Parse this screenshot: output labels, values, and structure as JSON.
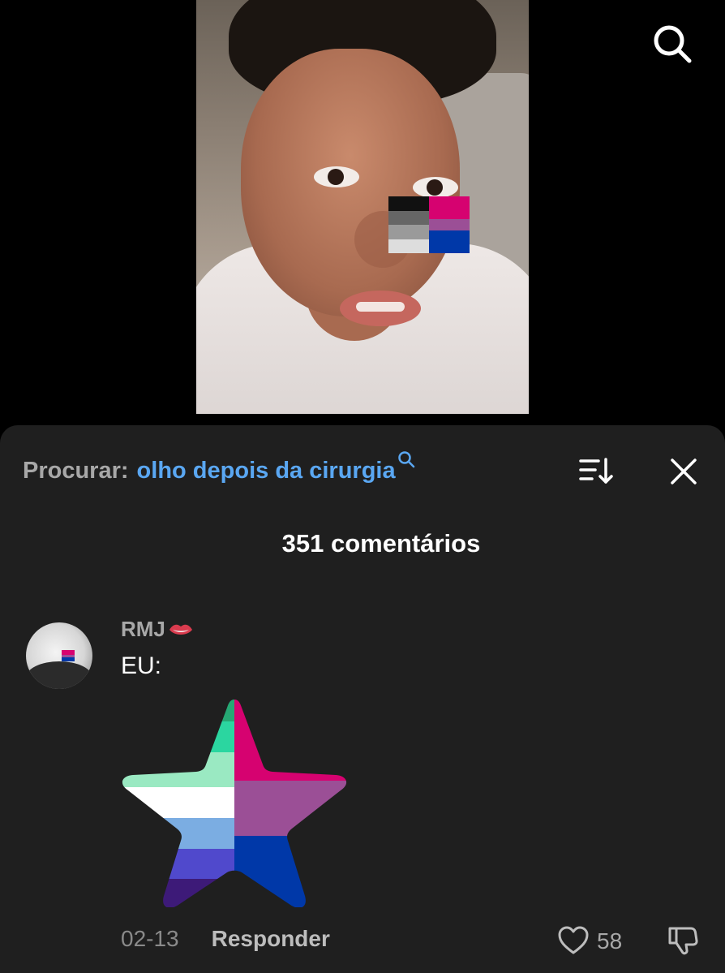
{
  "search": {
    "label": "Procurar:",
    "query": "olho depois da cirurgia"
  },
  "comments": {
    "count_label": "351 comentários",
    "items": [
      {
        "username": "RMJ",
        "text": "EU:",
        "date": "02-13",
        "reply_label": "Responder",
        "likes": "58"
      }
    ]
  },
  "colors": {
    "panel_bg": "#1f1f1f",
    "accent_blue": "#5aa7f2",
    "muted_text": "#a8a8a8"
  },
  "icons": [
    "search-icon",
    "sort-icon",
    "close-icon",
    "heart-icon",
    "dislike-icon",
    "lips-emoji-icon"
  ]
}
